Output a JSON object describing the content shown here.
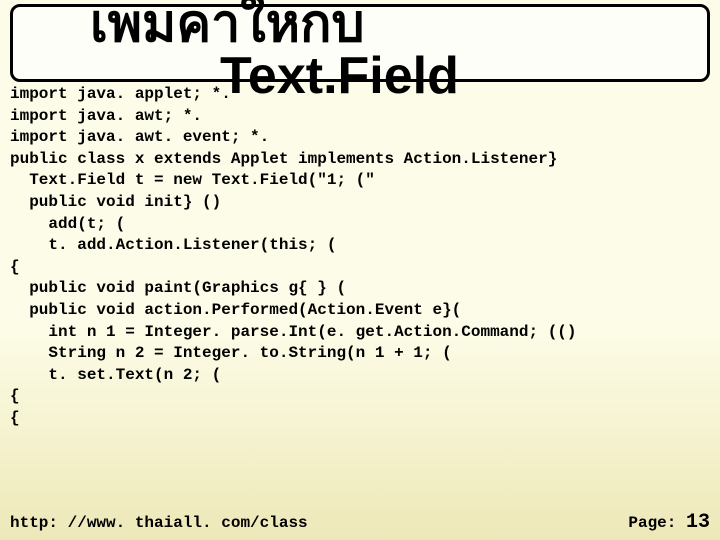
{
  "title": "เพมคาใหกบ\n         Text.Field",
  "code": [
    "import java. applet; *.",
    "import java. awt; *.",
    "import java. awt. event; *.",
    "public class x extends Applet implements Action.Listener}",
    "  Text.Field t = new Text.Field(\"1; (\"",
    "  public void init} ()",
    "    add(t; (",
    "    t. add.Action.Listener(this; (",
    "{",
    "  public void paint(Graphics g{ } (",
    "  public void action.Performed(Action.Event e}(",
    "    int n 1 = Integer. parse.Int(e. get.Action.Command; (()",
    "    String n 2 = Integer. to.String(n 1 + 1; (",
    "    t. set.Text(n 2; (",
    "{",
    "{"
  ],
  "footer": {
    "url": "http: //www. thaiall. com/class",
    "page_label": "Page:",
    "page_num": "13"
  }
}
